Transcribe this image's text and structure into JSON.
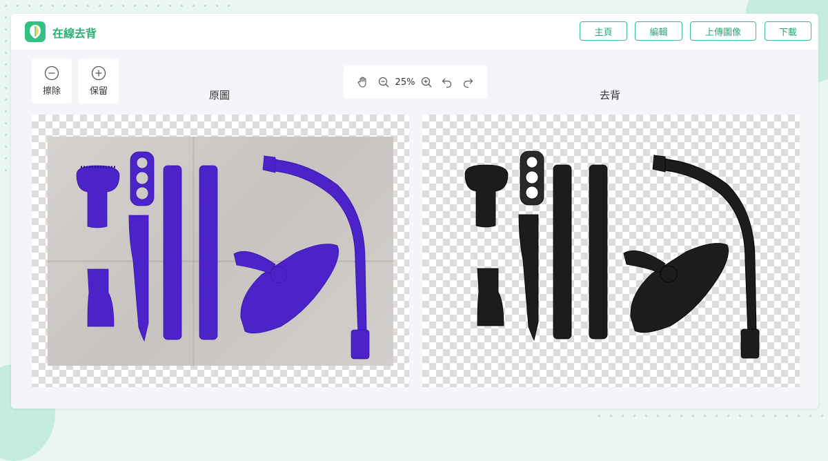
{
  "app": {
    "brand": "在線去背"
  },
  "nav": {
    "home": "主頁",
    "edit": "編輯",
    "upload": "上傳圖像",
    "download": "下載"
  },
  "tools": {
    "erase": "擦除",
    "keep": "保留"
  },
  "zoom": {
    "value": "25%"
  },
  "panels": {
    "original_title": "原圖",
    "removed_title": "去背"
  },
  "colors": {
    "accent": "#32c183",
    "object_original": "#4b23c9",
    "object_removed": "#1c1c1e"
  },
  "icons": {
    "logo": "leaf-logo-icon",
    "erase": "minus-circle-icon",
    "keep": "plus-circle-icon",
    "pan": "hand-icon",
    "zoom_out": "zoom-out-icon",
    "zoom_in": "zoom-in-icon",
    "undo": "undo-icon",
    "redo": "redo-icon"
  }
}
